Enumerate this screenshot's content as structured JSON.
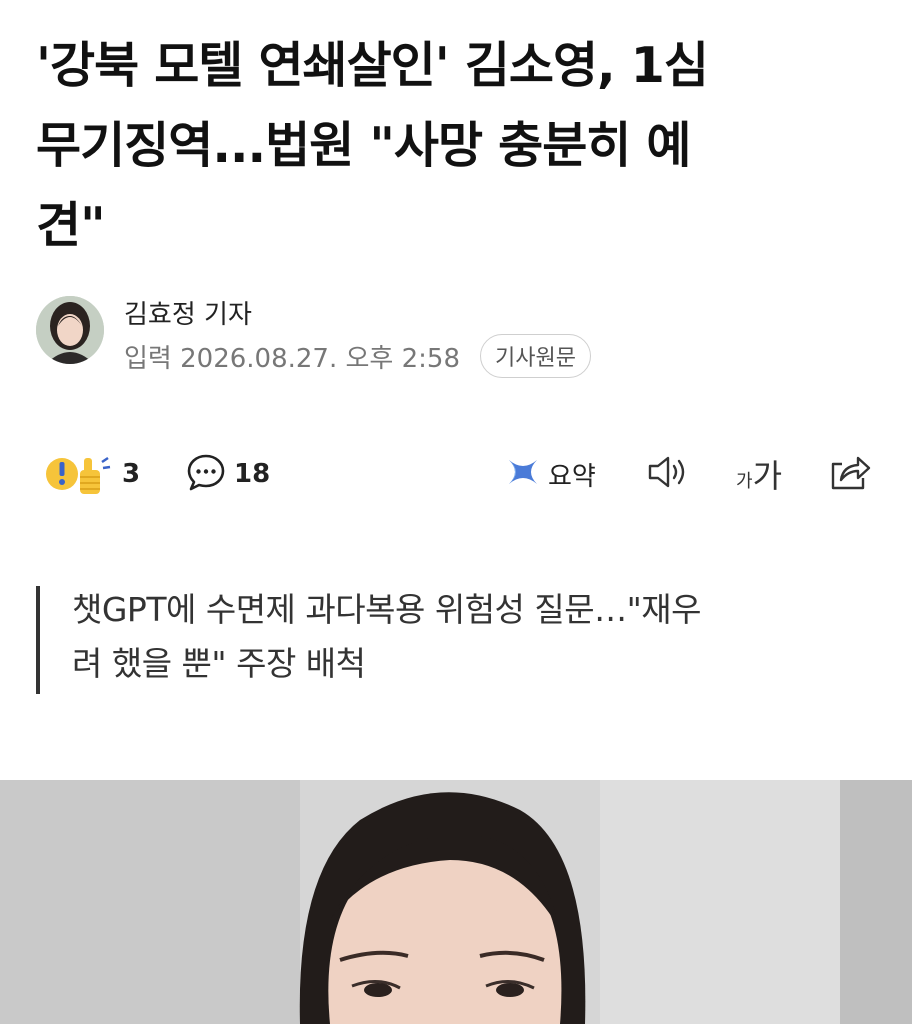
{
  "article": {
    "headline_lines": [
      "'강북 모텔 연쇄살인' 김소영, 1심",
      "무기징역...법원 \"사망 충분히 예",
      "견\""
    ],
    "reporter": "김효정 기자",
    "input_time": "입력 2026.08.27. 오후 2:58",
    "original_label": "기사원문",
    "subhead_lines": [
      "챗GPT에 수면제 과다복용 위험성 질문…\"재우",
      "려 했을 뿐\" 주장 배척"
    ]
  },
  "toolbar": {
    "reaction_count": "3",
    "comment_count": "18",
    "summary_label": "요약",
    "fontsize_small": "가",
    "fontsize_large": "가"
  },
  "icons": {
    "reaction": "reaction-emoji-icon",
    "comment": "speech-bubble-icon",
    "summary": "ai-summary-icon",
    "tts": "speaker-icon",
    "fontsize": "font-size-icon",
    "share": "share-icon"
  },
  "colors": {
    "summary_icon": "#4a7bd8",
    "reaction_yellow": "#f6c43a",
    "reaction_blue": "#3a63c9"
  }
}
